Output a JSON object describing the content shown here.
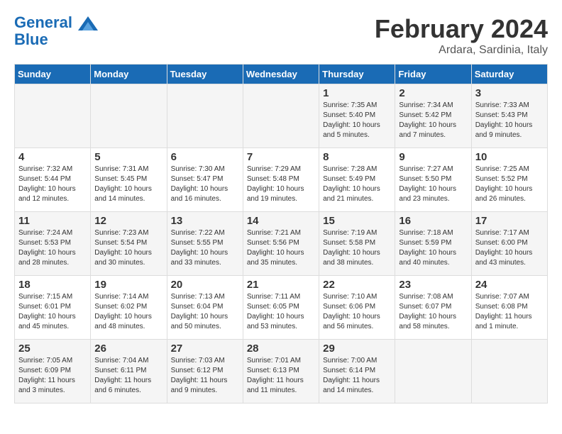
{
  "logo": {
    "line1": "General",
    "line2": "Blue"
  },
  "title": "February 2024",
  "subtitle": "Ardara, Sardinia, Italy",
  "days_of_week": [
    "Sunday",
    "Monday",
    "Tuesday",
    "Wednesday",
    "Thursday",
    "Friday",
    "Saturday"
  ],
  "weeks": [
    [
      {
        "day": "",
        "info": ""
      },
      {
        "day": "",
        "info": ""
      },
      {
        "day": "",
        "info": ""
      },
      {
        "day": "",
        "info": ""
      },
      {
        "day": "1",
        "info": "Sunrise: 7:35 AM\nSunset: 5:40 PM\nDaylight: 10 hours\nand 5 minutes."
      },
      {
        "day": "2",
        "info": "Sunrise: 7:34 AM\nSunset: 5:42 PM\nDaylight: 10 hours\nand 7 minutes."
      },
      {
        "day": "3",
        "info": "Sunrise: 7:33 AM\nSunset: 5:43 PM\nDaylight: 10 hours\nand 9 minutes."
      }
    ],
    [
      {
        "day": "4",
        "info": "Sunrise: 7:32 AM\nSunset: 5:44 PM\nDaylight: 10 hours\nand 12 minutes."
      },
      {
        "day": "5",
        "info": "Sunrise: 7:31 AM\nSunset: 5:45 PM\nDaylight: 10 hours\nand 14 minutes."
      },
      {
        "day": "6",
        "info": "Sunrise: 7:30 AM\nSunset: 5:47 PM\nDaylight: 10 hours\nand 16 minutes."
      },
      {
        "day": "7",
        "info": "Sunrise: 7:29 AM\nSunset: 5:48 PM\nDaylight: 10 hours\nand 19 minutes."
      },
      {
        "day": "8",
        "info": "Sunrise: 7:28 AM\nSunset: 5:49 PM\nDaylight: 10 hours\nand 21 minutes."
      },
      {
        "day": "9",
        "info": "Sunrise: 7:27 AM\nSunset: 5:50 PM\nDaylight: 10 hours\nand 23 minutes."
      },
      {
        "day": "10",
        "info": "Sunrise: 7:25 AM\nSunset: 5:52 PM\nDaylight: 10 hours\nand 26 minutes."
      }
    ],
    [
      {
        "day": "11",
        "info": "Sunrise: 7:24 AM\nSunset: 5:53 PM\nDaylight: 10 hours\nand 28 minutes."
      },
      {
        "day": "12",
        "info": "Sunrise: 7:23 AM\nSunset: 5:54 PM\nDaylight: 10 hours\nand 30 minutes."
      },
      {
        "day": "13",
        "info": "Sunrise: 7:22 AM\nSunset: 5:55 PM\nDaylight: 10 hours\nand 33 minutes."
      },
      {
        "day": "14",
        "info": "Sunrise: 7:21 AM\nSunset: 5:56 PM\nDaylight: 10 hours\nand 35 minutes."
      },
      {
        "day": "15",
        "info": "Sunrise: 7:19 AM\nSunset: 5:58 PM\nDaylight: 10 hours\nand 38 minutes."
      },
      {
        "day": "16",
        "info": "Sunrise: 7:18 AM\nSunset: 5:59 PM\nDaylight: 10 hours\nand 40 minutes."
      },
      {
        "day": "17",
        "info": "Sunrise: 7:17 AM\nSunset: 6:00 PM\nDaylight: 10 hours\nand 43 minutes."
      }
    ],
    [
      {
        "day": "18",
        "info": "Sunrise: 7:15 AM\nSunset: 6:01 PM\nDaylight: 10 hours\nand 45 minutes."
      },
      {
        "day": "19",
        "info": "Sunrise: 7:14 AM\nSunset: 6:02 PM\nDaylight: 10 hours\nand 48 minutes."
      },
      {
        "day": "20",
        "info": "Sunrise: 7:13 AM\nSunset: 6:04 PM\nDaylight: 10 hours\nand 50 minutes."
      },
      {
        "day": "21",
        "info": "Sunrise: 7:11 AM\nSunset: 6:05 PM\nDaylight: 10 hours\nand 53 minutes."
      },
      {
        "day": "22",
        "info": "Sunrise: 7:10 AM\nSunset: 6:06 PM\nDaylight: 10 hours\nand 56 minutes."
      },
      {
        "day": "23",
        "info": "Sunrise: 7:08 AM\nSunset: 6:07 PM\nDaylight: 10 hours\nand 58 minutes."
      },
      {
        "day": "24",
        "info": "Sunrise: 7:07 AM\nSunset: 6:08 PM\nDaylight: 11 hours\nand 1 minute."
      }
    ],
    [
      {
        "day": "25",
        "info": "Sunrise: 7:05 AM\nSunset: 6:09 PM\nDaylight: 11 hours\nand 3 minutes."
      },
      {
        "day": "26",
        "info": "Sunrise: 7:04 AM\nSunset: 6:11 PM\nDaylight: 11 hours\nand 6 minutes."
      },
      {
        "day": "27",
        "info": "Sunrise: 7:03 AM\nSunset: 6:12 PM\nDaylight: 11 hours\nand 9 minutes."
      },
      {
        "day": "28",
        "info": "Sunrise: 7:01 AM\nSunset: 6:13 PM\nDaylight: 11 hours\nand 11 minutes."
      },
      {
        "day": "29",
        "info": "Sunrise: 7:00 AM\nSunset: 6:14 PM\nDaylight: 11 hours\nand 14 minutes."
      },
      {
        "day": "",
        "info": ""
      },
      {
        "day": "",
        "info": ""
      }
    ]
  ]
}
